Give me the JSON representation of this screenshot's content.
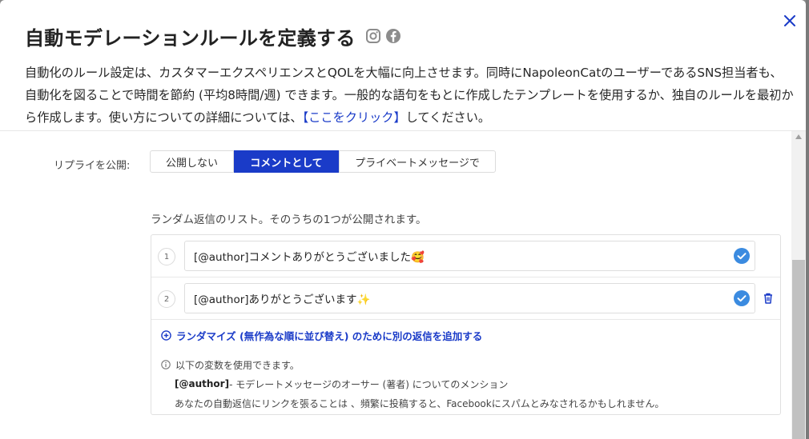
{
  "modal": {
    "title": "自動モデレーションルールを定義する",
    "icons": [
      "instagram-icon",
      "facebook-icon",
      "close-icon"
    ],
    "description_part1": "自動化のルール設定は、カスタマーエクスペリエンスとQOLを大幅に向上させます。同時にNapoleonCatのユーザーであるSNS担当者も、自動化を図ることで時間を節約 (平均8時間/週) できます。一般的な語句をもとに作成したテンプレートを使用するか、独自のルールを最初から作成します。使い方についての詳細については、",
    "description_link": "【ここをクリック】",
    "description_part2": "してください。"
  },
  "reply_publish": {
    "label": "リプライを公開:",
    "options": [
      "公開しない",
      "コメントとして",
      "プライベートメッセージで"
    ],
    "selected": "コメントとして"
  },
  "random_replies": {
    "caption": "ランダム返信のリスト。そのうちの1つが公開されます。",
    "items": [
      {
        "number": "1",
        "text": "[@author]コメントありがとうございました🥰"
      },
      {
        "number": "2",
        "text": "[@author]ありがとうございます✨"
      }
    ],
    "add_link": "ランダマイズ (無作為な順に並び替え) のために別の返信を追加する"
  },
  "variables": {
    "intro": "以下の変数を使用できます。",
    "token": "[@author]",
    "token_desc": " - モデレートメッセージのオーサー (著者) についてのメンション",
    "warning": "あなたの自動返信にリンクを張ることは 、頻繁に投稿すると、Facebookにスパムとみなされるかもしれません。"
  },
  "colors": {
    "accent": "#1a3bc8",
    "check": "#3b8be0"
  }
}
